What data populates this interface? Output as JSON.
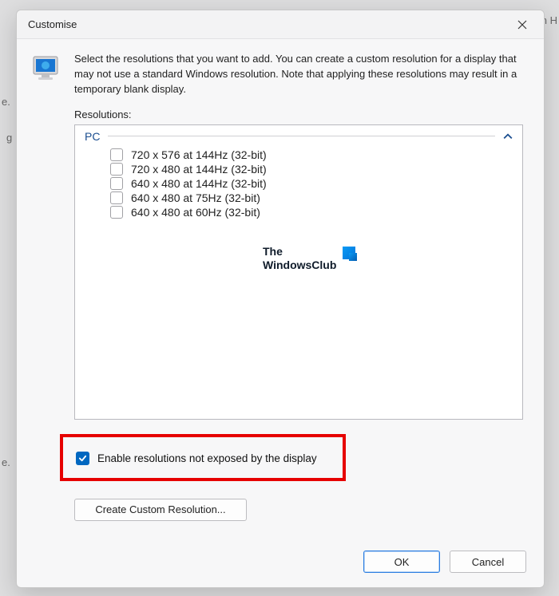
{
  "titlebar": {
    "title": "Customise"
  },
  "intro": {
    "text": "Select the resolutions that you want to add. You can create a custom resolution for a display that may not use a standard Windows resolution. Note that applying these resolutions may result in a temporary blank display."
  },
  "resolutions": {
    "label": "Resolutions:",
    "group": "PC",
    "items": [
      "720 x 576 at 144Hz (32-bit)",
      "720 x 480 at 144Hz (32-bit)",
      "640 x 480 at 144Hz (32-bit)",
      "640 x 480 at 75Hz (32-bit)",
      "640 x 480 at 60Hz (32-bit)"
    ]
  },
  "watermark": {
    "line1": "The",
    "line2": "WindowsClub"
  },
  "enable": {
    "checked": true,
    "label": "Enable resolutions not exposed by the display"
  },
  "buttons": {
    "create": "Create Custom Resolution...",
    "ok": "OK",
    "cancel": "Cancel"
  },
  "bg": {
    "frag1": "e.",
    "frag2": "g",
    "frag3": "n H",
    "frag4": "e."
  }
}
